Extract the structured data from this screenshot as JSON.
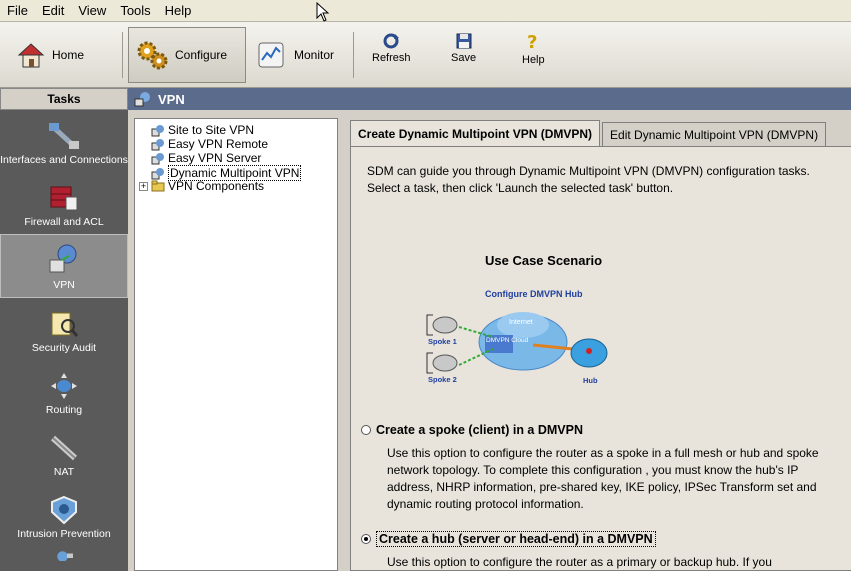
{
  "menu": [
    "File",
    "Edit",
    "View",
    "Tools",
    "Help"
  ],
  "toolbar": {
    "home": "Home",
    "configure": "Configure",
    "monitor": "Monitor",
    "refresh": "Refresh",
    "save": "Save",
    "help": "Help"
  },
  "tasks": {
    "header": "Tasks",
    "items": [
      {
        "label": "Interfaces and Connections",
        "icon": "interfaces-icon"
      },
      {
        "label": "Firewall and ACL",
        "icon": "firewall-icon"
      },
      {
        "label": "VPN",
        "icon": "vpn-icon"
      },
      {
        "label": "Security Audit",
        "icon": "security-audit-icon"
      },
      {
        "label": "Routing",
        "icon": "routing-icon"
      },
      {
        "label": "NAT",
        "icon": "nat-icon"
      },
      {
        "label": "Intrusion Prevention",
        "icon": "intrusion-prevention-icon"
      }
    ]
  },
  "section": {
    "title": "VPN"
  },
  "tree": {
    "items": [
      "Site to Site VPN",
      "Easy VPN Remote",
      "Easy VPN Server",
      "Dynamic Multipoint VPN",
      "VPN Components"
    ]
  },
  "tabs": [
    "Create Dynamic Multipoint VPN (DMVPN)",
    "Edit Dynamic Multipoint VPN (DMVPN)"
  ],
  "content": {
    "intro": "SDM can guide you through Dynamic Multipoint VPN (DMVPN) configuration tasks. Select a task, then click 'Launch the selected task' button.",
    "use_case_title": "Use Case Scenario",
    "diagram": {
      "title": "Configure DMVPN Hub",
      "internet": "Internet",
      "cloud": "DMVPN Cloud",
      "spoke1": "Spoke 1",
      "spoke2": "Spoke 2",
      "hub": "Hub"
    },
    "option1": {
      "label": "Create a spoke (client) in a DMVPN",
      "desc": "Use this option to configure the router as a spoke in a full mesh or hub and spoke network topology. To complete this configuration , you must know the hub's IP address, NHRP information, pre-shared key, IKE policy, IPSec Transform set and dynamic routing protocol information."
    },
    "option2": {
      "label": "Create a hub (server or head-end) in a DMVPN",
      "desc": "Use this option to configure the router as a primary or backup hub. If you"
    }
  },
  "colors": {
    "section_header": "#5a6b8c",
    "tasks_bg": "#5a5a5a",
    "diagram_title": "#1f3f9f"
  }
}
